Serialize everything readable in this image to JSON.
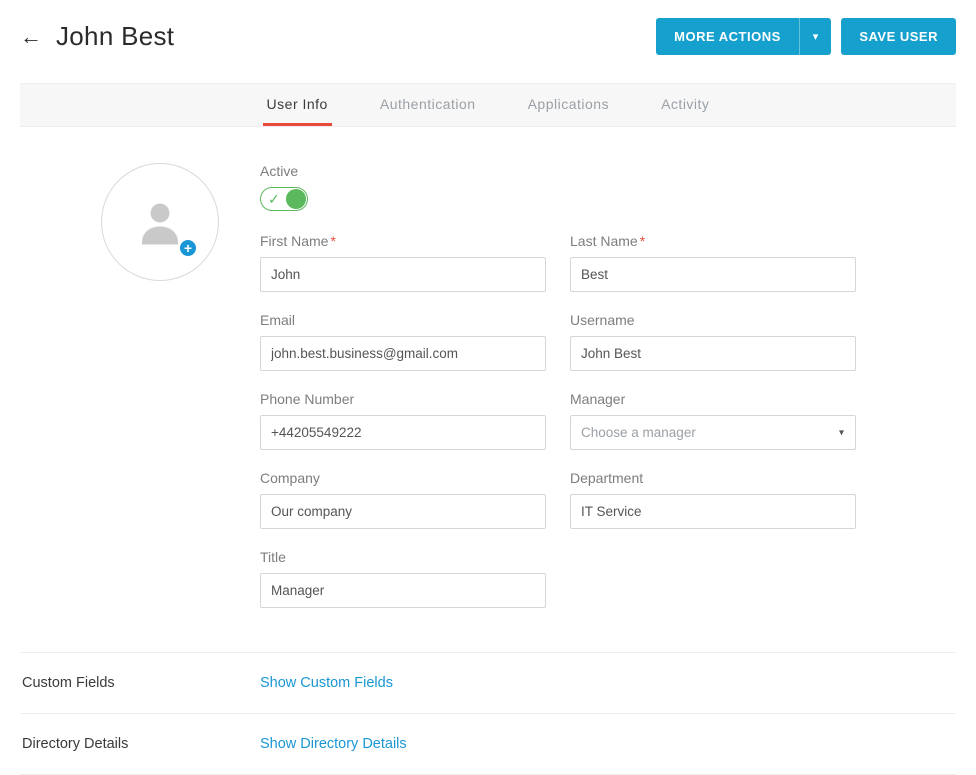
{
  "header": {
    "title": "John Best",
    "more_actions_label": "MORE ACTIONS",
    "save_label": "SAVE USER"
  },
  "tabs": [
    {
      "label": "User Info",
      "active": true
    },
    {
      "label": "Authentication",
      "active": false
    },
    {
      "label": "Applications",
      "active": false
    },
    {
      "label": "Activity",
      "active": false
    }
  ],
  "form": {
    "active_label": "Active",
    "first_name_label": "First Name",
    "first_name_value": "John",
    "last_name_label": "Last Name",
    "last_name_value": "Best",
    "email_label": "Email",
    "email_value": "john.best.business@gmail.com",
    "username_label": "Username",
    "username_value": "John Best",
    "phone_label": "Phone Number",
    "phone_value": "+44205549222",
    "manager_label": "Manager",
    "manager_placeholder": "Choose a manager",
    "company_label": "Company",
    "company_value": "Our company",
    "department_label": "Department",
    "department_value": "IT Service",
    "title_label": "Title",
    "title_value": "Manager"
  },
  "sections": {
    "custom_fields_label": "Custom Fields",
    "custom_fields_link": "Show Custom Fields",
    "directory_label": "Directory Details",
    "directory_link": "Show Directory Details"
  }
}
